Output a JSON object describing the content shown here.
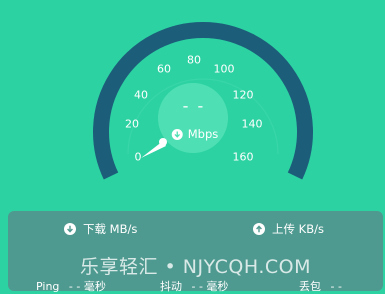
{
  "gauge": {
    "labels": [
      "0",
      "20",
      "40",
      "60",
      "80",
      "100",
      "120",
      "140",
      "160"
    ],
    "value_display": "- -",
    "unit": "Mbps"
  },
  "panel": {
    "download_label": "下载 MB/s",
    "upload_label": "上传 KB/s",
    "ping_label": "Ping",
    "ping_value": "- - 毫秒",
    "jitter_label": "抖动",
    "jitter_value": "- - 毫秒",
    "loss_label": "丢包",
    "loss_value": "- -"
  },
  "watermark": "乐享轻汇 • NJYCQH.COM",
  "colors": {
    "background": "#2dd2a2",
    "arc": "#1c5d7a",
    "center_circle": "#4ee0b4",
    "panel": "#4f9a90"
  }
}
